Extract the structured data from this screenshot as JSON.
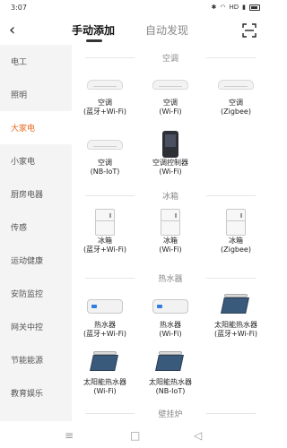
{
  "status": {
    "time": "3:07",
    "network": "HD"
  },
  "topbar": {
    "tab_manual": "手动添加",
    "tab_auto": "自动发现"
  },
  "sidebar": {
    "items": [
      {
        "label": "电工"
      },
      {
        "label": "照明"
      },
      {
        "label": "大家电"
      },
      {
        "label": "小家电"
      },
      {
        "label": "厨房电器"
      },
      {
        "label": "传感"
      },
      {
        "label": "运动健康"
      },
      {
        "label": "安防监控"
      },
      {
        "label": "网关中控"
      },
      {
        "label": "节能能源"
      },
      {
        "label": "教育娱乐"
      }
    ],
    "active": "大家电"
  },
  "sections": {
    "ac": {
      "title": "空调",
      "devices": [
        {
          "name": "空调",
          "sub": "(蓝牙+Wi-Fi)"
        },
        {
          "name": "空调",
          "sub": "(Wi-Fi)"
        },
        {
          "name": "空调",
          "sub": "(Zigbee)"
        },
        {
          "name": "空调",
          "sub": "(NB-IoT)"
        },
        {
          "name": "空调控制器",
          "sub": "(Wi-Fi)"
        }
      ]
    },
    "fridge": {
      "title": "冰箱",
      "devices": [
        {
          "name": "冰箱",
          "sub": "(蓝牙+Wi-Fi)"
        },
        {
          "name": "冰箱",
          "sub": "(Wi-Fi)"
        },
        {
          "name": "冰箱",
          "sub": "(Zigbee)"
        }
      ]
    },
    "heater": {
      "title": "热水器",
      "devices": [
        {
          "name": "热水器",
          "sub": "(蓝牙+Wi-Fi)"
        },
        {
          "name": "热水器",
          "sub": "(Wi-Fi)"
        },
        {
          "name": "太阳能热水器",
          "sub": "(蓝牙+Wi-Fi)"
        },
        {
          "name": "太阳能热水器",
          "sub": "(Wi-Fi)"
        },
        {
          "name": "太阳能热水器",
          "sub": "(NB-IoT)"
        }
      ]
    },
    "wall": {
      "title": "壁挂炉"
    }
  },
  "navbar": {
    "menu": "≡",
    "home": "□",
    "back": "◁"
  }
}
